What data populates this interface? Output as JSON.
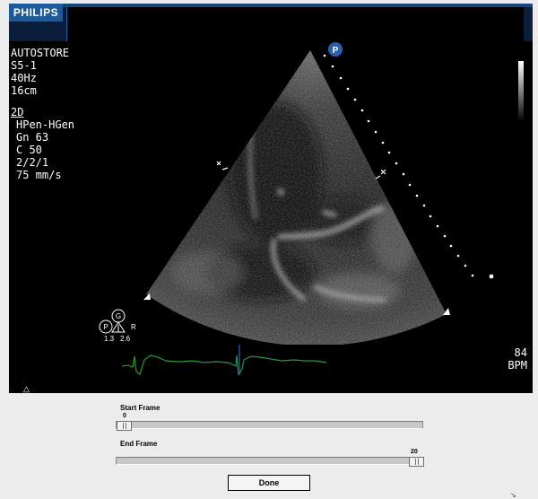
{
  "brand": "PHILIPS",
  "scan_params": {
    "preset": "AUTOSTORE",
    "probe": "S5-1",
    "frame_rate": "40Hz",
    "depth": "16cm",
    "mode": "2D",
    "harmonics": "HPen-HGen",
    "gain": "Gn 63",
    "compression": "C 50",
    "persistence": "2/2/1",
    "sweep": "75 mm/s"
  },
  "sector_marker": "P",
  "orientation_icon": {
    "p_label": "P",
    "g_label": "G",
    "r_label": "R",
    "left_value": "1.3",
    "right_value": "2.6"
  },
  "heart_rate": {
    "value": "84",
    "unit": "BPM"
  },
  "ecg_color": "#1f9a3a",
  "start_frame": {
    "label": "Start Frame",
    "value": "0",
    "position": 0
  },
  "end_frame": {
    "label": "End Frame",
    "value": "20",
    "position": 1
  },
  "done_label": "Done"
}
